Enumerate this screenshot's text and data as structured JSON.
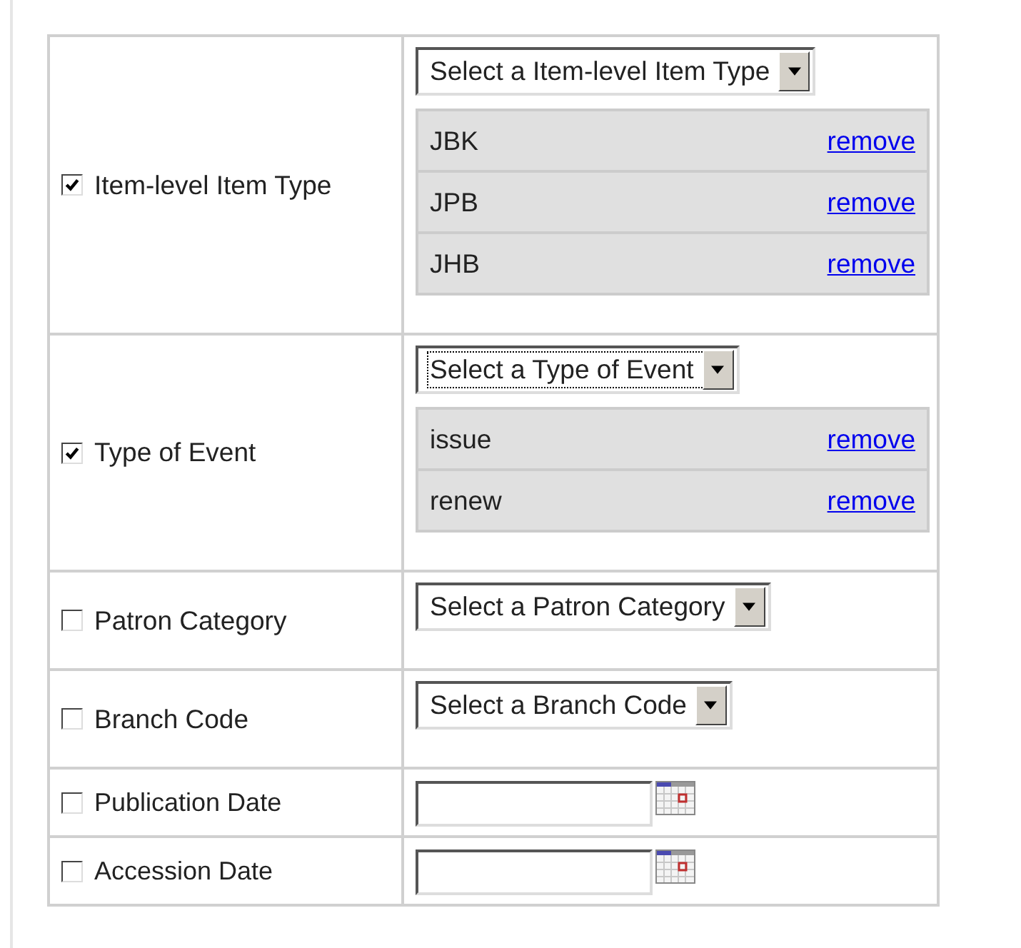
{
  "rows": [
    {
      "kind": "select",
      "label": "Item-level Item Type",
      "checked": true,
      "select": {
        "text": "Select a Item-level Item Type",
        "focused": false
      },
      "values": [
        {
          "name": "JBK",
          "link": "remove"
        },
        {
          "name": "JPB",
          "link": "remove"
        },
        {
          "name": "JHB",
          "link": "remove"
        }
      ]
    },
    {
      "kind": "select",
      "label": "Type of Event",
      "checked": true,
      "select": {
        "text": "Select a Type of Event",
        "focused": true
      },
      "values": [
        {
          "name": "issue",
          "link": "remove"
        },
        {
          "name": "renew",
          "link": "remove"
        }
      ]
    },
    {
      "kind": "select",
      "label": "Patron Category",
      "checked": false,
      "select": {
        "text": "Select a Patron Category",
        "focused": false
      }
    },
    {
      "kind": "select",
      "label": "Branch Code",
      "checked": false,
      "select": {
        "text": "Select a Branch Code",
        "focused": false
      }
    },
    {
      "kind": "date",
      "label": "Publication Date",
      "checked": false
    },
    {
      "kind": "date",
      "label": "Accession Date",
      "checked": false
    }
  ]
}
